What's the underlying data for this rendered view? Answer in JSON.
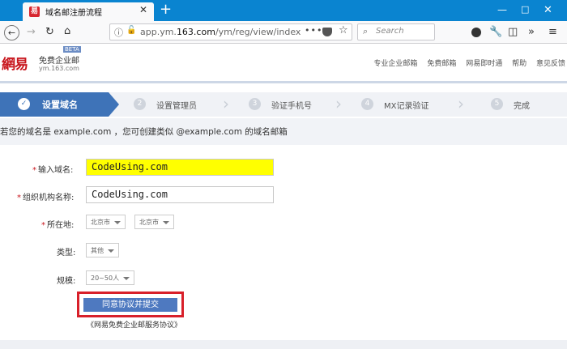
{
  "browser": {
    "tab_title": "域名邮注册流程",
    "tab_favicon": "易",
    "close_glyph": "✕",
    "new_tab_glyph": "+",
    "url_prefix": "app.ym.",
    "url_domain": "163.com",
    "url_path": "/ym/reg/view/index",
    "url_more": "•••",
    "search_placeholder": "Search",
    "icons": [
      "back-arrow-icon",
      "forward-arrow-icon",
      "reload-icon",
      "home-icon",
      "info-icon",
      "insecure-lock-icon",
      "page-actions-icon",
      "pocket-icon",
      "bookmark-star-icon",
      "search-icon",
      "extension-icon",
      "tools-icon",
      "sidebar-icon",
      "overflow-icon",
      "menu-icon"
    ]
  },
  "header": {
    "logo_main": "網易",
    "logo_sub": "免费企业邮",
    "logo_beta": "BETA",
    "logo_domain": "ym.163.com",
    "links": [
      "专业企业邮箱",
      "免费邮箱",
      "网易即时通",
      "帮助",
      "意见反馈"
    ]
  },
  "steps": [
    {
      "num": "✓",
      "label": "设置域名",
      "active": true
    },
    {
      "num": "2",
      "label": "设置管理员",
      "active": false
    },
    {
      "num": "3",
      "label": "验证手机号",
      "active": false
    },
    {
      "num": "4",
      "label": "MX记录验证",
      "active": false
    },
    {
      "num": "5",
      "label": "完成",
      "active": false
    }
  ],
  "notice": "若您的域名是 example.com ，您可创建类似 @example.com 的域名邮箱",
  "form": {
    "required_mark": "*",
    "domain_label": "输入域名:",
    "domain_value": "CodeUsing.com",
    "org_label": "组织机构名称:",
    "org_value": "CodeUsing.com",
    "location_label": "所在地:",
    "province": "北京市",
    "city": "北京市",
    "type_label": "类型:",
    "type_value": "其他",
    "size_label": "规模:",
    "size_value": "20~50人",
    "submit_label": "同意协议并提交",
    "agreement": "《网易免费企业邮服务协议》"
  },
  "colors": {
    "accent": "#3e73b8",
    "highlight": "#ffff00",
    "annotation_box": "#d8202a"
  }
}
